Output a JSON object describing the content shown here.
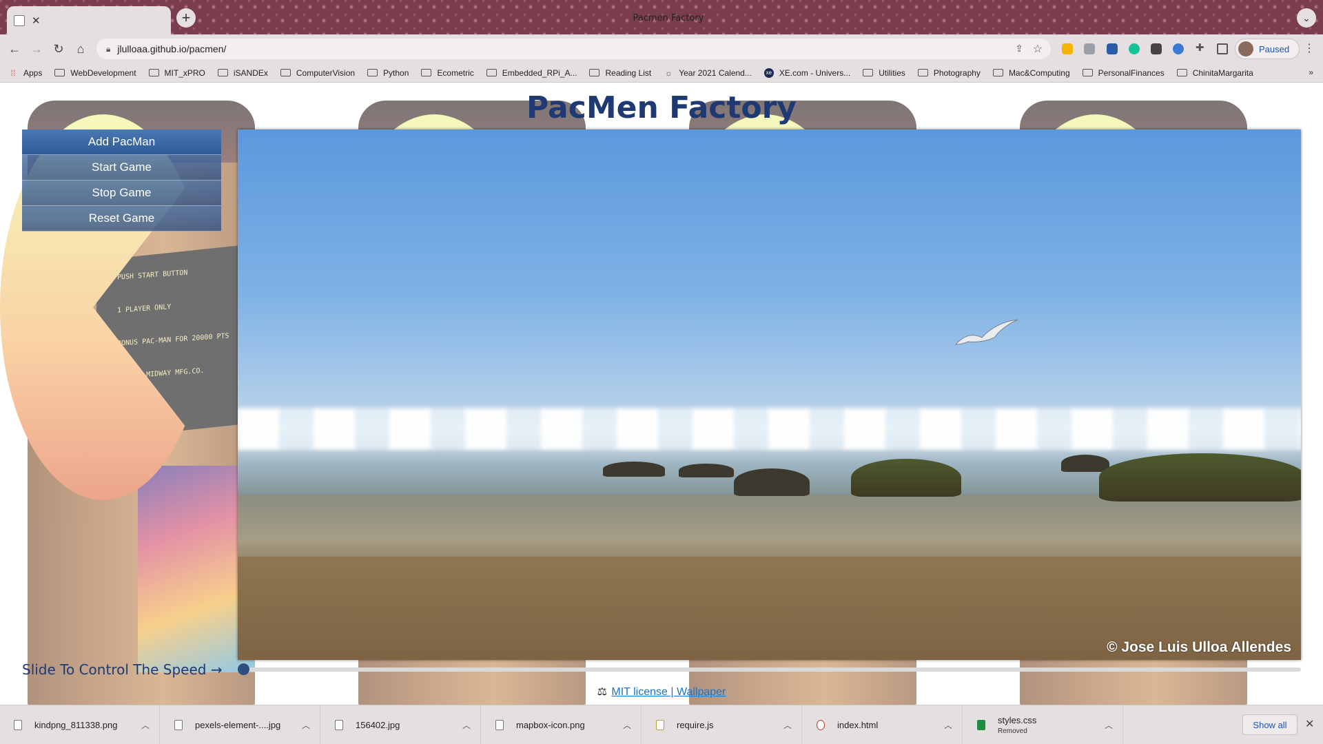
{
  "browser": {
    "tab_title": "Pacmen Factory",
    "tab_close": "✕",
    "new_tab": "+",
    "tab_menu": "⌄",
    "url": "jlulloaa.github.io/pacmen/",
    "profile_label": "Paused"
  },
  "bookmarks": [
    {
      "label": "Apps",
      "icon": "apps-grid-icon"
    },
    {
      "label": "WebDevelopment",
      "icon": "folder-icon"
    },
    {
      "label": "MIT_xPRO",
      "icon": "folder-icon"
    },
    {
      "label": "iSANDEx",
      "icon": "folder-icon"
    },
    {
      "label": "ComputerVision",
      "icon": "folder-icon"
    },
    {
      "label": "Python",
      "icon": "folder-icon"
    },
    {
      "label": "Ecometric",
      "icon": "folder-icon"
    },
    {
      "label": "Embedded_RPi_A...",
      "icon": "folder-icon"
    },
    {
      "label": "Reading List",
      "icon": "folder-icon"
    },
    {
      "label": "Year 2021 Calend...",
      "icon": "calendar-icon"
    },
    {
      "label": "XE.com - Univers...",
      "icon": "xe-icon"
    },
    {
      "label": "Utilities",
      "icon": "folder-icon"
    },
    {
      "label": "Photography",
      "icon": "folder-icon"
    },
    {
      "label": "Mac&Computing",
      "icon": "folder-icon"
    },
    {
      "label": "PersonalFinances",
      "icon": "folder-icon"
    },
    {
      "label": "ChinitaMargarita",
      "icon": "folder-icon"
    }
  ],
  "bookmarks_overflow": "»",
  "page": {
    "title": "PacMen Factory",
    "menu": {
      "add": "Add PacMan",
      "start": "Start Game",
      "stop": "Stop Game",
      "reset": "Reset Game"
    },
    "wallpaper_credit": "© Jose Luis Ulloa Allendes",
    "speed_label": "Slide To Control The Speed →",
    "speed_value": 0,
    "footer": {
      "icon": "⚖",
      "license_link": "MIT license | Wallpaper"
    },
    "arcade_screen_text": "PUSH START BUTTON\n\n1 PLAYER ONLY\n\nBONUS PAC-MAN FOR 20000 PTS\n\n© 1980 MIDWAY MFG.CO."
  },
  "downloads": [
    {
      "name": "kindpng_811338.png",
      "sub": ""
    },
    {
      "name": "pexels-element-....jpg",
      "sub": ""
    },
    {
      "name": "156402.jpg",
      "sub": ""
    },
    {
      "name": "mapbox-icon.png",
      "sub": ""
    },
    {
      "name": "require.js",
      "sub": ""
    },
    {
      "name": "index.html",
      "sub": ""
    },
    {
      "name": "styles.css",
      "sub": "Removed"
    }
  ],
  "downloads_show_all": "Show all",
  "colors": {
    "title": "#1f3a73",
    "menu": "#2f5a94",
    "link": "#1a73c8",
    "tabstrip": "#7a3d4d"
  }
}
